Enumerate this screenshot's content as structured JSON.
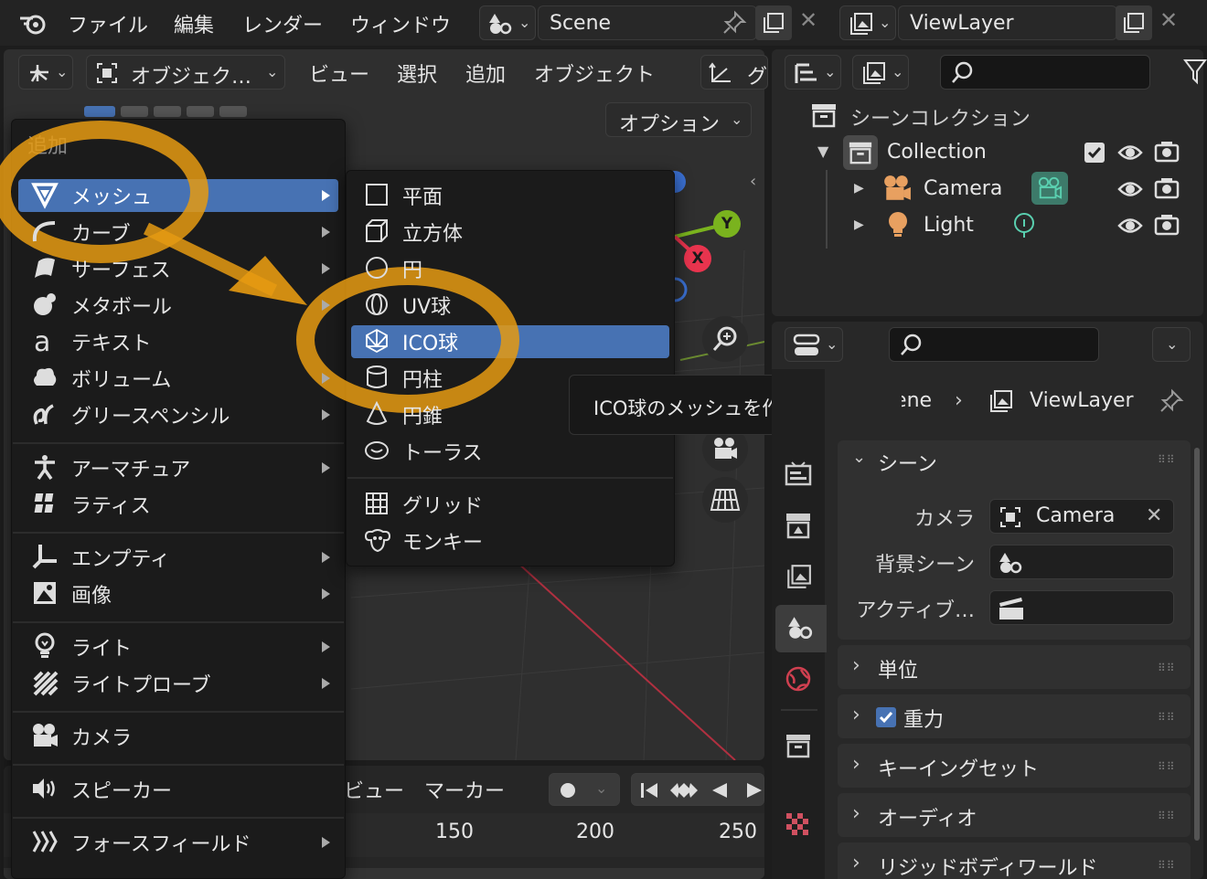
{
  "topbar": {
    "menus": [
      "ファイル",
      "編集",
      "レンダー",
      "ウィンドウ"
    ],
    "scene_name": "Scene",
    "viewlayer_name": "ViewLayer"
  },
  "viewport_header": {
    "mode_label": "オブジェク…",
    "menus": [
      "ビュー",
      "選択",
      "追加",
      "オブジェクト"
    ],
    "extra_partial": "グ",
    "options_label": "オプション"
  },
  "add_menu": {
    "title": "追加",
    "items": [
      {
        "label": "メッシュ",
        "icon": "mesh-icon",
        "submenu": true,
        "selected": true
      },
      {
        "label": "カーブ",
        "icon": "curve-icon",
        "submenu": true
      },
      {
        "label": "サーフェス",
        "icon": "surface-icon",
        "submenu": true
      },
      {
        "label": "メタボール",
        "icon": "metaball-icon",
        "submenu": true
      },
      {
        "label": "テキスト",
        "icon": "text-icon",
        "submenu": false
      },
      {
        "label": "ボリューム",
        "icon": "volume-icon",
        "submenu": true
      },
      {
        "label": "グリースペンシル",
        "icon": "grease-pencil-icon",
        "submenu": true
      },
      {
        "label": "アーマチュア",
        "icon": "armature-icon",
        "submenu": true
      },
      {
        "label": "ラティス",
        "icon": "lattice-icon",
        "submenu": false
      },
      {
        "label": "エンプティ",
        "icon": "empty-icon",
        "submenu": true
      },
      {
        "label": "画像",
        "icon": "image-icon",
        "submenu": true
      },
      {
        "label": "ライト",
        "icon": "light-icon",
        "submenu": true
      },
      {
        "label": "ライトプローブ",
        "icon": "light-probe-icon",
        "submenu": true
      },
      {
        "label": "カメラ",
        "icon": "camera-icon",
        "submenu": false
      },
      {
        "label": "スピーカー",
        "icon": "speaker-icon",
        "submenu": false
      },
      {
        "label": "フォースフィールド",
        "icon": "force-field-icon",
        "submenu": true
      }
    ]
  },
  "mesh_menu": {
    "items": [
      {
        "label": "平面",
        "icon": "plane-icon"
      },
      {
        "label": "立方体",
        "icon": "cube-icon"
      },
      {
        "label": "円",
        "icon": "circle-icon"
      },
      {
        "label": "UV球",
        "icon": "uv-sphere-icon"
      },
      {
        "label": "ICO球",
        "icon": "ico-sphere-icon",
        "selected": true
      },
      {
        "label": "円柱",
        "icon": "cylinder-icon"
      },
      {
        "label": "円錐",
        "icon": "cone-icon"
      },
      {
        "label": "トーラス",
        "icon": "torus-icon"
      },
      {
        "label": "グリッド",
        "icon": "grid-icon"
      },
      {
        "label": "モンキー",
        "icon": "monkey-icon"
      }
    ]
  },
  "tooltip": "ICO球のメッシュを作成します。",
  "gizmo": {
    "y_label": "Y",
    "x_label": "X"
  },
  "timeline": {
    "menus": [
      "ビュー",
      "マーカー"
    ],
    "frames": [
      "150",
      "200",
      "250"
    ]
  },
  "outliner": {
    "scene_collection": "シーンコレクション",
    "collection": "Collection",
    "items": [
      {
        "label": "Camera"
      },
      {
        "label": "Light"
      }
    ]
  },
  "properties": {
    "breadcrumb_scene": "Scene",
    "breadcrumb_viewlayer": "ViewLayer",
    "scene_panel": "シーン",
    "camera_label": "カメラ",
    "camera_value": "Camera",
    "background_label": "背景シーン",
    "active_label": "アクティブ…",
    "sections": [
      "単位",
      "重力",
      "キーイングセット",
      "オーディオ",
      "リジッドボディワールド"
    ]
  },
  "colors": {
    "accent": "#4772b3",
    "highlight_orange": "#e59a12",
    "axis_x": "#e8344e",
    "axis_y": "#7ab31e"
  }
}
